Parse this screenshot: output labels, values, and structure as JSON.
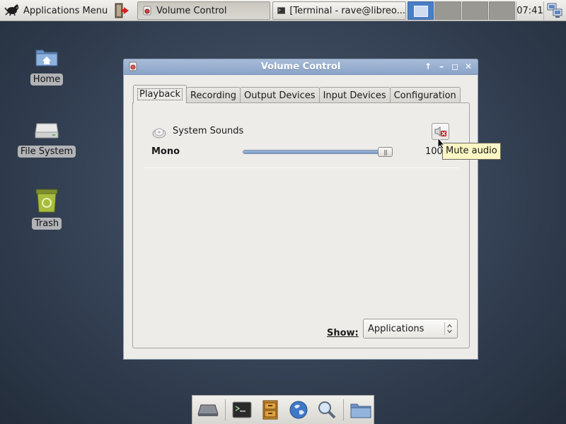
{
  "top_panel": {
    "apps_menu_label": "Applications Menu",
    "tasks": [
      {
        "label": "Volume Control",
        "icon": "volume-control-icon",
        "active": true
      },
      {
        "label": "[Terminal - rave@libreo...",
        "icon": "terminal-icon",
        "active": false
      }
    ],
    "workspaces": 4,
    "current_workspace": 1,
    "clock": "07:41"
  },
  "desktop_icons": [
    {
      "label": "Home",
      "icon": "home-folder-icon"
    },
    {
      "label": "File System",
      "icon": "drive-icon"
    },
    {
      "label": "Trash",
      "icon": "trash-icon"
    }
  ],
  "window": {
    "title": "Volume Control",
    "tabs": [
      "Playback",
      "Recording",
      "Output Devices",
      "Input Devices",
      "Configuration"
    ],
    "active_tab": "Playback",
    "stream": {
      "name": "System Sounds",
      "channel": "Mono",
      "volume_percent": 100,
      "volume_text": "100%",
      "mute_tooltip": "Mute audio"
    },
    "show_label": "Show:",
    "show_value": "Applications"
  },
  "dock": {
    "items": [
      "disk-icon",
      "terminal-icon",
      "file-cabinet-icon",
      "web-browser-icon",
      "search-icon",
      "folder-icon"
    ]
  },
  "colors": {
    "titlebar": "#8aa4c8",
    "workspace_active": "#4a7ec4",
    "slider_fill": "#7a9bc8",
    "tooltip_bg": "#fbf6c3"
  }
}
